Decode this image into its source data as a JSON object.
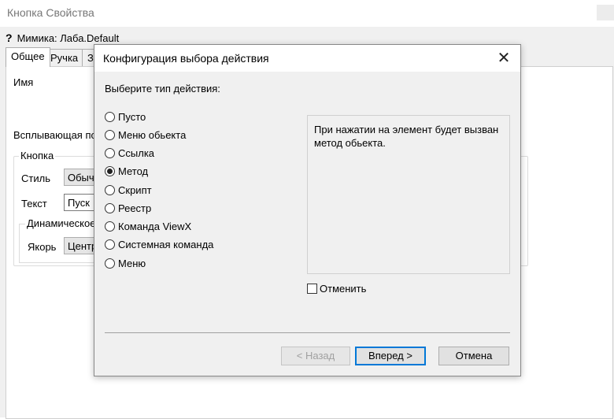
{
  "background_window": {
    "title": "Кнопка Свойства",
    "mimic_label": "Мимика: Лаба.Default",
    "tabs": [
      "Общее",
      "Ручка",
      "З"
    ],
    "fields": {
      "name_label": "Имя",
      "popup_label": "Всплывающая по",
      "button_group_label": "Кнопка",
      "style_label": "Стиль",
      "style_value": "Обыч",
      "text_label": "Текст",
      "text_value": "Пуск",
      "dynamic_group_label": "Динамическое",
      "anchor_label": "Якорь",
      "anchor_value": "Центр"
    }
  },
  "dialog": {
    "title": "Конфигурация выбора действия",
    "close_glyph": "✕",
    "prompt": "Выберите тип действия:",
    "options": [
      {
        "label": "Пусто",
        "checked": false
      },
      {
        "label": "Меню обьекта",
        "checked": false
      },
      {
        "label": "Ссылка",
        "checked": false
      },
      {
        "label": "Метод",
        "checked": true
      },
      {
        "label": "Скрипт",
        "checked": false
      },
      {
        "label": "Реестр",
        "checked": false
      },
      {
        "label": "Команда ViewX",
        "checked": false
      },
      {
        "label": "Системная команда",
        "checked": false
      },
      {
        "label": "Меню",
        "checked": false
      }
    ],
    "description": "При нажатии на элемент будет вызван метод обьекта.",
    "cancel_checkbox_label": "Отменить",
    "buttons": {
      "back": "< Назад",
      "next": "Вперед >",
      "cancel": "Отмена"
    }
  },
  "colors": {
    "accent": "#0078d7",
    "dialog_bg": "#f0f0f0"
  }
}
